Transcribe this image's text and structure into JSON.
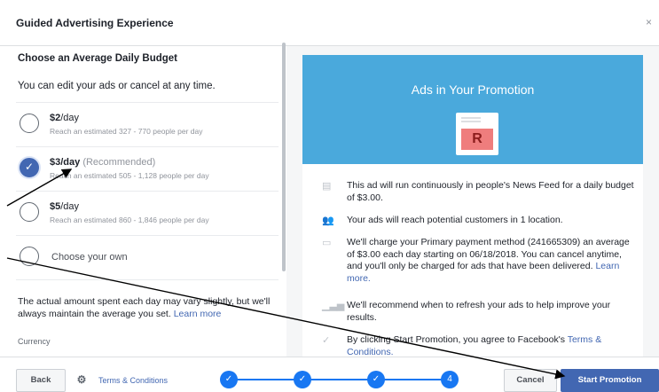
{
  "window": {
    "title": "Guided Advertising Experience",
    "close_glyph": "×"
  },
  "budget": {
    "heading": "Choose an Average Daily Budget",
    "subheading": "You can edit your ads or cancel at any time.",
    "options": [
      {
        "price": "$2",
        "unit": "/day",
        "note": "",
        "reach": "Reach an estimated 327 - 770 people per day",
        "selected": false
      },
      {
        "price": "$3",
        "unit": "/day",
        "note": " (Recommended)",
        "reach": "Reach an estimated 505 - 1,128 people per day",
        "selected": true
      },
      {
        "price": "$5",
        "unit": "/day",
        "note": "",
        "reach": "Reach an estimated 860 - 1,846 people per day",
        "selected": false
      }
    ],
    "custom_label": "Choose your own",
    "footnote": "The actual amount spent each day may vary slightly, but we'll always maintain the average you set.",
    "footnote_link": "Learn more",
    "currency_label": "Currency"
  },
  "promo": {
    "title": "Ads in Your Promotion",
    "thumb_letter": "R",
    "items": [
      {
        "icon": "news-feed-icon",
        "text": "This ad will run continuously in people's News Feed for a daily budget of $3.00.",
        "link": ""
      },
      {
        "icon": "people-icon",
        "text": "Your ads will reach potential customers in 1 location.",
        "link": ""
      },
      {
        "icon": "credit-card-icon",
        "text": "We'll charge your Primary payment method (241665309) an average of $3.00 each day starting on 06/18/2018. You can cancel anytime, and you'll only be charged for ads that have been delivered.",
        "link": "Learn more."
      },
      {
        "icon": "bar-chart-icon",
        "text": "We'll recommend when to refresh your ads to help improve your results.",
        "link": ""
      },
      {
        "icon": "checkmark-icon",
        "text": "By clicking Start Promotion, you agree to Facebook's",
        "link": "Terms & Conditions."
      }
    ]
  },
  "footer": {
    "back_label": "Back",
    "terms_label": "Terms & Conditions",
    "steps": [
      "✓",
      "✓",
      "✓",
      "4"
    ],
    "cancel_label": "Cancel",
    "start_label": "Start Promotion"
  }
}
